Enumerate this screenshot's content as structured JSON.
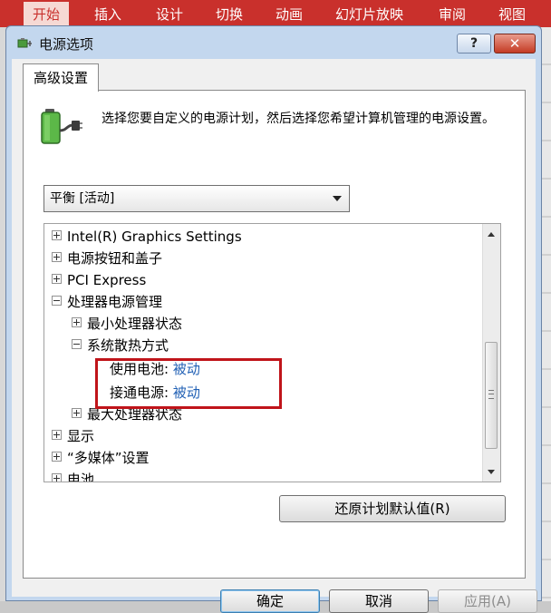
{
  "ribbon": {
    "tabs": [
      "开始",
      "插入",
      "设计",
      "切换",
      "动画",
      "幻灯片放映",
      "审阅",
      "视图"
    ],
    "active_tab": "开始",
    "accent": "#c9302c"
  },
  "dialog": {
    "title": "电源选项",
    "help_label": "?",
    "close_label": "✕",
    "tab_label": "高级设置",
    "description": "选择您要自定义的电源计划，然后选择您希望计算机管理的电源设置。",
    "plan_selected": "平衡 [活动]",
    "restore_label": "还原计划默认值(R)",
    "ok_label": "确定",
    "cancel_label": "取消",
    "apply_label": "应用(A)"
  },
  "tree": {
    "graphics": "Intel(R) Graphics Settings",
    "power_buttons": "电源按钮和盖子",
    "pci": "PCI Express",
    "cpu_mgmt": "处理器电源管理",
    "min_cpu": "最小处理器状态",
    "cooling": "系统散热方式",
    "battery_label": "使用电池:",
    "battery_value": "被动",
    "plugged_label": "接通电源:",
    "plugged_value": "被动",
    "max_cpu": "最大处理器状态",
    "display": "显示",
    "multimedia": "“多媒体”设置",
    "battery": "电池"
  },
  "icons": {
    "title": "power-options-icon",
    "battery": "battery-plug-icon"
  }
}
